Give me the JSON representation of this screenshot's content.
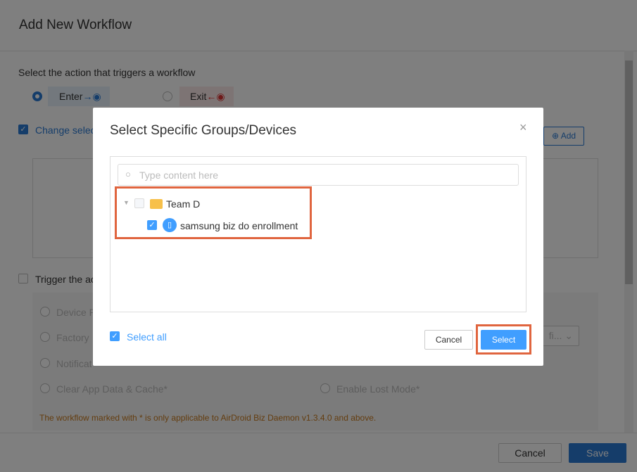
{
  "dialog": {
    "title": "Add New Workflow",
    "prompt": "Select the action that triggers a workflow",
    "enter_label": "Enter",
    "exit_label": "Exit",
    "change_label": "Change selec",
    "add_label": "Add",
    "trigger_label": "Trigger the ac",
    "options": [
      "Device R",
      "Factory",
      "Notificat",
      "Clear App Data & Cache*",
      "Enable Lost Mode*"
    ],
    "dropdown_value": "fi...",
    "warning": "The workflow marked with * is only applicable to AirDroid Biz Daemon v1.3.4.0 and above.",
    "cancel_label": "Cancel",
    "save_label": "Save"
  },
  "modal": {
    "title": "Select Specific Groups/Devices",
    "search_placeholder": "Type content here",
    "tree": {
      "group": "Team D",
      "device": "samsung biz do enrollment"
    },
    "select_all": "Select all",
    "cancel_label": "Cancel",
    "select_label": "Select"
  },
  "colors": {
    "primary": "#409eff",
    "highlight": "#e0653f",
    "warning": "#c87a1e"
  }
}
